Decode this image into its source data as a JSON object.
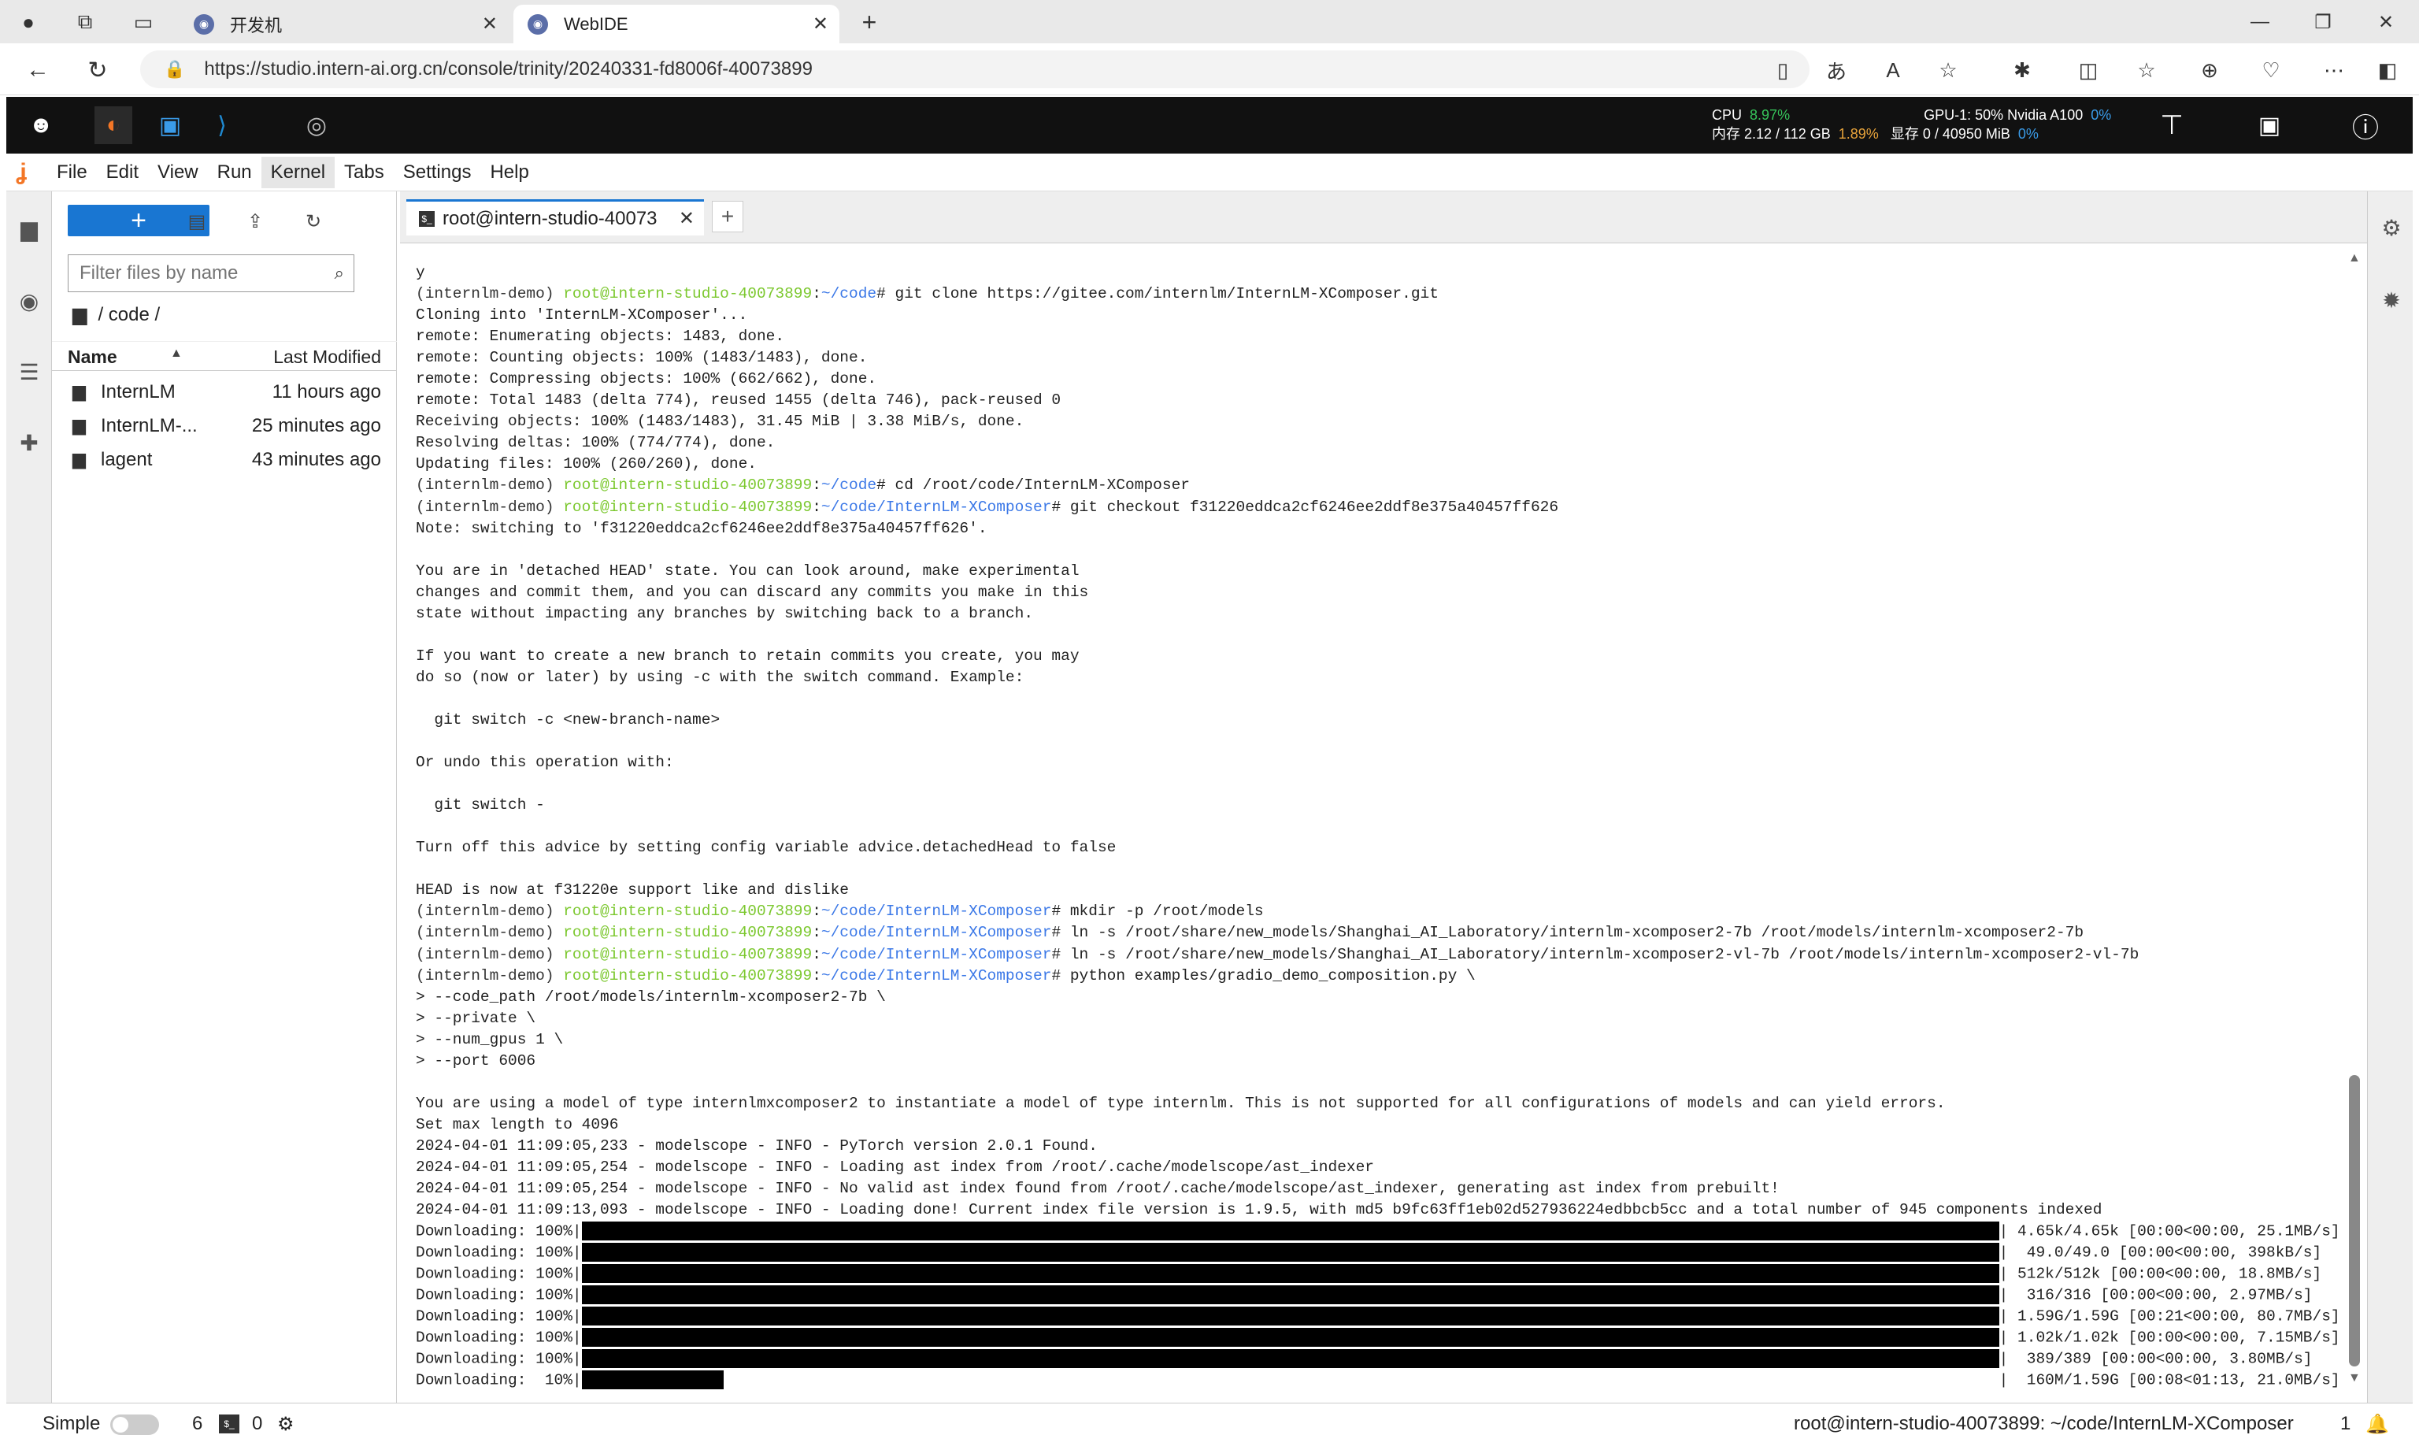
{
  "browser": {
    "tabs": [
      {
        "title": "开发机",
        "active": false
      },
      {
        "title": "WebIDE",
        "active": true
      }
    ],
    "url": "https://studio.intern-ai.org.cn/console/trinity/20240331-fd8006f-40073899"
  },
  "topbar": {
    "cpu_label": "CPU",
    "cpu_value": "8.97%",
    "mem_label": "内存 2.12 / 112 GB",
    "mem_value": "1.89%",
    "gpu_label": "GPU-1: 50% Nvidia A100",
    "gpu_value": "0%",
    "vram_label": "显存 0 / 40950 MiB",
    "vram_value": "0%"
  },
  "menu": [
    "File",
    "Edit",
    "View",
    "Run",
    "Kernel",
    "Tabs",
    "Settings",
    "Help"
  ],
  "filebrowser": {
    "filter_placeholder": "Filter files by name",
    "breadcrumb": "/ code /",
    "col_name": "Name",
    "col_modified": "Last Modified",
    "files": [
      {
        "name": "InternLM",
        "modified": "11 hours ago"
      },
      {
        "name": "InternLM-...",
        "modified": "25 minutes ago"
      },
      {
        "name": "lagent",
        "modified": "43 minutes ago"
      }
    ]
  },
  "terminal": {
    "tab_title": "root@intern-studio-40073",
    "lines": [
      {
        "t": "y"
      },
      {
        "p": true,
        "env": "(internlm-demo) ",
        "user": "root@intern-studio-40073899",
        "path": "~/code",
        "cmd": "# git clone https://gitee.com/internlm/InternLM-XComposer.git"
      },
      {
        "t": "Cloning into 'InternLM-XComposer'..."
      },
      {
        "t": "remote: Enumerating objects: 1483, done."
      },
      {
        "t": "remote: Counting objects: 100% (1483/1483), done."
      },
      {
        "t": "remote: Compressing objects: 100% (662/662), done."
      },
      {
        "t": "remote: Total 1483 (delta 774), reused 1455 (delta 746), pack-reused 0"
      },
      {
        "t": "Receiving objects: 100% (1483/1483), 31.45 MiB | 3.38 MiB/s, done."
      },
      {
        "t": "Resolving deltas: 100% (774/774), done."
      },
      {
        "t": "Updating files: 100% (260/260), done."
      },
      {
        "p": true,
        "env": "(internlm-demo) ",
        "user": "root@intern-studio-40073899",
        "path": "~/code",
        "cmd": "# cd /root/code/InternLM-XComposer"
      },
      {
        "p": true,
        "env": "(internlm-demo) ",
        "user": "root@intern-studio-40073899",
        "path": "~/code/InternLM-XComposer",
        "cmd": "# git checkout f31220eddca2cf6246ee2ddf8e375a40457ff626"
      },
      {
        "t": "Note: switching to 'f31220eddca2cf6246ee2ddf8e375a40457ff626'."
      },
      {
        "t": ""
      },
      {
        "t": "You are in 'detached HEAD' state. You can look around, make experimental"
      },
      {
        "t": "changes and commit them, and you can discard any commits you make in this"
      },
      {
        "t": "state without impacting any branches by switching back to a branch."
      },
      {
        "t": ""
      },
      {
        "t": "If you want to create a new branch to retain commits you create, you may"
      },
      {
        "t": "do so (now or later) by using -c with the switch command. Example:"
      },
      {
        "t": ""
      },
      {
        "t": "  git switch -c <new-branch-name>"
      },
      {
        "t": ""
      },
      {
        "t": "Or undo this operation with:"
      },
      {
        "t": ""
      },
      {
        "t": "  git switch -"
      },
      {
        "t": ""
      },
      {
        "t": "Turn off this advice by setting config variable advice.detachedHead to false"
      },
      {
        "t": ""
      },
      {
        "t": "HEAD is now at f31220e support like and dislike"
      },
      {
        "p": true,
        "env": "(internlm-demo) ",
        "user": "root@intern-studio-40073899",
        "path": "~/code/InternLM-XComposer",
        "cmd": "# mkdir -p /root/models"
      },
      {
        "p": true,
        "env": "(internlm-demo) ",
        "user": "root@intern-studio-40073899",
        "path": "~/code/InternLM-XComposer",
        "cmd": "# ln -s /root/share/new_models/Shanghai_AI_Laboratory/internlm-xcomposer2-7b /root/models/internlm-xcomposer2-7b"
      },
      {
        "p": true,
        "env": "(internlm-demo) ",
        "user": "root@intern-studio-40073899",
        "path": "~/code/InternLM-XComposer",
        "cmd": "# ln -s /root/share/new_models/Shanghai_AI_Laboratory/internlm-xcomposer2-vl-7b /root/models/internlm-xcomposer2-vl-7b"
      },
      {
        "p": true,
        "env": "(internlm-demo) ",
        "user": "root@intern-studio-40073899",
        "path": "~/code/InternLM-XComposer",
        "cmd": "# python examples/gradio_demo_composition.py \\"
      },
      {
        "t": "> --code_path /root/models/internlm-xcomposer2-7b \\"
      },
      {
        "t": "> --private \\"
      },
      {
        "t": "> --num_gpus 1 \\"
      },
      {
        "t": "> --port 6006"
      },
      {
        "t": ""
      },
      {
        "t": "You are using a model of type internlmxcomposer2 to instantiate a model of type internlm. This is not supported for all configurations of models and can yield errors."
      },
      {
        "t": "Set max length to 4096"
      },
      {
        "t": "2024-04-01 11:09:05,233 - modelscope - INFO - PyTorch version 2.0.1 Found."
      },
      {
        "t": "2024-04-01 11:09:05,254 - modelscope - INFO - Loading ast index from /root/.cache/modelscope/ast_indexer"
      },
      {
        "t": "2024-04-01 11:09:05,254 - modelscope - INFO - No valid ast index found from /root/.cache/modelscope/ast_indexer, generating ast index from prebuilt!"
      },
      {
        "t": "2024-04-01 11:09:13,093 - modelscope - INFO - Loading done! Current index file version is 1.9.5, with md5 b9fc63ff1eb02d527936224edbbcb5cc and a total number of 945 components indexed"
      }
    ],
    "downloads": [
      {
        "pct": "100%",
        "frac": 1.0,
        "tail": "4.65k/4.65k [00:00<00:00, 25.1MB/s]"
      },
      {
        "pct": "100%",
        "frac": 1.0,
        "tail": " 49.0/49.0 [00:00<00:00, 398kB/s]"
      },
      {
        "pct": "100%",
        "frac": 1.0,
        "tail": "512k/512k [00:00<00:00, 18.8MB/s]"
      },
      {
        "pct": "100%",
        "frac": 1.0,
        "tail": " 316/316 [00:00<00:00, 2.97MB/s]"
      },
      {
        "pct": "100%",
        "frac": 1.0,
        "tail": "1.59G/1.59G [00:21<00:00, 80.7MB/s]"
      },
      {
        "pct": "100%",
        "frac": 1.0,
        "tail": "1.02k/1.02k [00:00<00:00, 7.15MB/s]"
      },
      {
        "pct": "100%",
        "frac": 1.0,
        "tail": " 389/389 [00:00<00:00, 3.80MB/s]"
      },
      {
        "pct": " 10%",
        "frac": 0.1,
        "tail": " 160M/1.59G [00:08<01:13, 21.0MB/s]"
      }
    ],
    "download_label": "Downloading: "
  },
  "statusbar": {
    "mode": "Simple",
    "terminals": "6",
    "kernels": "0",
    "path": "root@intern-studio-40073899: ~/code/InternLM-XComposer",
    "notifications": "1"
  }
}
